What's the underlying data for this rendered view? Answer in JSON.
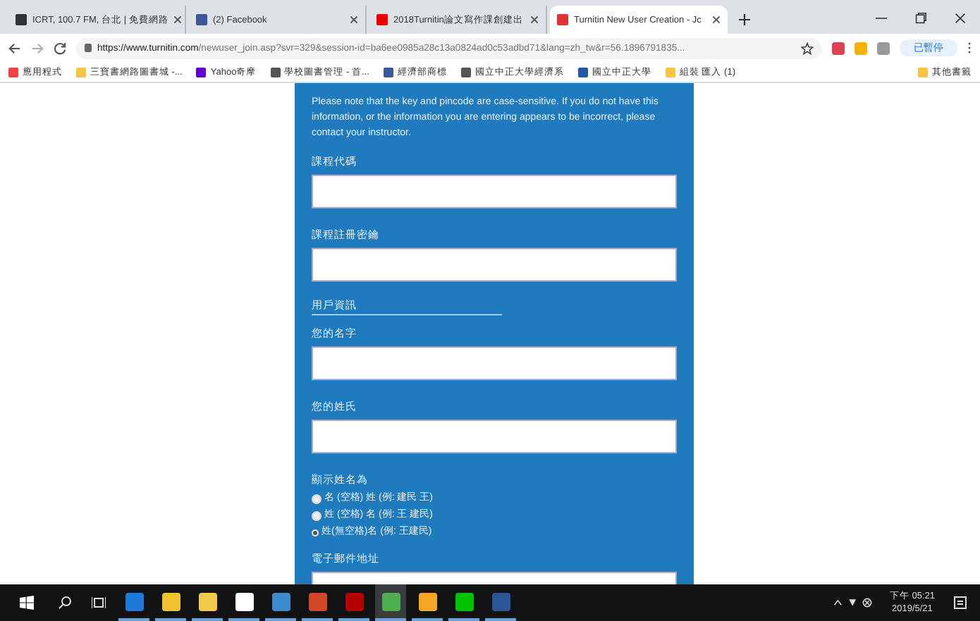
{
  "tabs": [
    {
      "label": "ICRT, 100.7 FM, 台北 | 免費網路",
      "selected": false
    },
    {
      "label": "(2) Facebook",
      "selected": false
    },
    {
      "label": "2018Turnitin論文寫作課創建出",
      "selected": false
    },
    {
      "label": "Turnitin New User Creation - Jc",
      "selected": true
    }
  ],
  "address": {
    "domain": "https://www.turnitin.com",
    "path": "/newuser_join.asp?svr=329&session-id=ba6ee0985a28c13a0824ad0c53adbd71&lang=zh_tw&r=56.1896791835..."
  },
  "profile": "已暫停",
  "bookmarks": [
    {
      "label": "應用程式"
    },
    {
      "label": "三寶書網路圖書城 -..."
    },
    {
      "label": "Yahoo奇摩"
    },
    {
      "label": "學校圖書管理 - 首..."
    },
    {
      "label": "經濟部商標"
    },
    {
      "label": "國立中正大學經濟系"
    },
    {
      "label": "國立中正大學"
    },
    {
      "label": "組裝 匯入 (1)"
    }
  ],
  "other_bookmarks": "其他書籤",
  "form": {
    "note": "Please note that the key and pincode are case-sensitive. If you do not have this information, or the information you are entering appears to be incorrect, please contact your instructor.",
    "class_fields": [
      {
        "label": "課程代碼"
      },
      {
        "label": "課程註冊密鑰"
      }
    ],
    "section": "用戶資訊",
    "name_fields": [
      {
        "label": "您的名字"
      },
      {
        "label": "您的姓氏"
      }
    ],
    "display_label": "顯示姓名為",
    "display_options": [
      {
        "label": "名 (空格) 姓 (例: 建民 王)",
        "selected": false
      },
      {
        "label": "姓 (空格) 名 (例: 王 建民)",
        "selected": false
      },
      {
        "label": "姓(無空格)名 (例: 王建民)",
        "selected": true
      }
    ],
    "email_label": "電子郵件地址"
  },
  "taskbar": {
    "time": "下午 05:21",
    "date": "2019/5/21",
    "apps": [
      {
        "selected": false
      },
      {
        "selected": false
      },
      {
        "selected": false
      },
      {
        "selected": false
      },
      {
        "selected": false
      },
      {
        "selected": false
      },
      {
        "selected": false
      },
      {
        "selected": true
      },
      {
        "selected": false
      },
      {
        "selected": false
      },
      {
        "selected": false
      }
    ]
  }
}
